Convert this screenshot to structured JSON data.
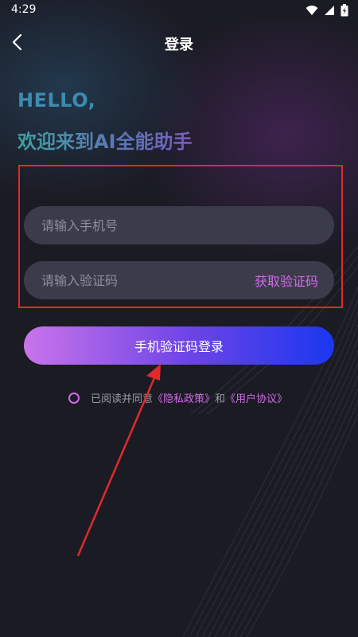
{
  "status_bar": {
    "time": "4:29"
  },
  "nav": {
    "title": "登录"
  },
  "greeting": {
    "line1": "HELLO,",
    "line2": "欢迎来到AI全能助手"
  },
  "form": {
    "phone_placeholder": "请输入手机号",
    "code_placeholder": "请输入验证码",
    "get_code_label": "获取验证码",
    "login_label": "手机验证码登录"
  },
  "agreement": {
    "prefix": "已阅读并同意",
    "privacy_link": "《隐私政策》",
    "joiner": "和",
    "terms_link": "《用户协议》"
  },
  "colors": {
    "background": "#1b1b24",
    "input_bg": "#3b3b4b",
    "accent": "#d26ae8",
    "button_start": "#c974ea",
    "button_end": "#1a37f0",
    "annotation_red": "#e02a2a"
  },
  "icons": {
    "back": "chevron-left-icon",
    "wifi": "wifi-icon",
    "signal": "signal-icon",
    "battery": "battery-icon"
  }
}
